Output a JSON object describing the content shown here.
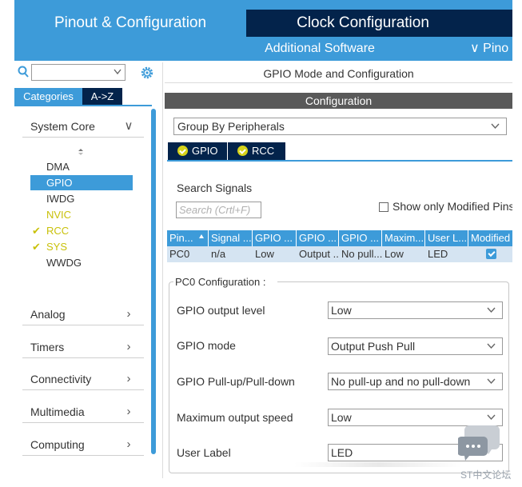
{
  "header": {
    "tabs": [
      {
        "label": "Pinout & Configuration",
        "active": true
      },
      {
        "label": "Clock Configuration",
        "active": false
      }
    ],
    "additional_software": "Additional Software",
    "pinout_menu": "Pino"
  },
  "left": {
    "search": {
      "value": "",
      "placeholder": ""
    },
    "tabs": {
      "categories": "Categories",
      "az": "A->Z"
    },
    "system_core": {
      "label": "System Core",
      "items": [
        {
          "label": "DMA",
          "state": "normal"
        },
        {
          "label": "GPIO",
          "state": "selected"
        },
        {
          "label": "IWDG",
          "state": "normal"
        },
        {
          "label": "NVIC",
          "state": "warning"
        },
        {
          "label": "RCC",
          "state": "checked"
        },
        {
          "label": "SYS",
          "state": "checked"
        },
        {
          "label": "WWDG",
          "state": "normal"
        }
      ]
    },
    "categories": [
      {
        "label": "Analog"
      },
      {
        "label": "Timers"
      },
      {
        "label": "Connectivity"
      },
      {
        "label": "Multimedia"
      },
      {
        "label": "Computing"
      }
    ]
  },
  "right": {
    "title": "GPIO Mode and Configuration",
    "config_header": "Configuration",
    "group_by": "Group By Peripherals",
    "peripheral_tabs": [
      {
        "label": "GPIO"
      },
      {
        "label": "RCC"
      }
    ],
    "search_signals_label": "Search Signals",
    "search_signals_placeholder": "Search (Crtl+F)",
    "show_modified_label": "Show only Modified Pins",
    "show_modified_checked": false,
    "table": {
      "headers": [
        "Pin...",
        "Signal ...",
        "GPIO ...",
        "GPIO ...",
        "GPIO ...",
        "Maxim...",
        "User L...",
        "Modified"
      ],
      "rows": [
        [
          "PC0",
          "n/a",
          "Low",
          "Output ...",
          "No pull...",
          "Low",
          "LED",
          ""
        ]
      ],
      "modified": [
        true
      ]
    },
    "pc0_config": {
      "title": "PC0 Configuration :",
      "fields": [
        {
          "label": "GPIO output level",
          "value": "Low"
        },
        {
          "label": "GPIO mode",
          "value": "Output Push Pull"
        },
        {
          "label": "GPIO Pull-up/Pull-down",
          "value": "No pull-up and no pull-down"
        },
        {
          "label": "Maximum output speed",
          "value": "Low"
        }
      ],
      "user_label": {
        "label": "User Label",
        "value": "LED"
      }
    }
  },
  "watermark": {
    "text": "ST中文论坛"
  },
  "colors": {
    "accent": "#3d9bd9",
    "dark_navy": "#03234b",
    "config_header": "#595959",
    "warning_yellow": "#c9c10a",
    "row_highlight": "#d5e4f2"
  }
}
